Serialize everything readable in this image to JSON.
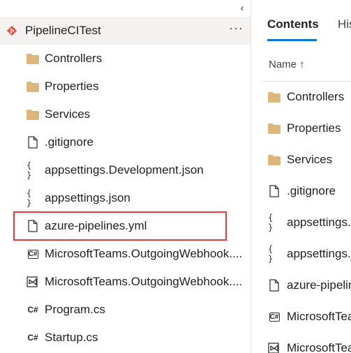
{
  "tree": {
    "collapse_glyph": "‹",
    "repo": {
      "name": "PipelineCITest",
      "icon": "git-repo-icon",
      "more": "···"
    },
    "items": [
      {
        "label": "Controllers",
        "icon": "folder-icon"
      },
      {
        "label": "Properties",
        "icon": "folder-icon"
      },
      {
        "label": "Services",
        "icon": "folder-icon"
      },
      {
        "label": ".gitignore",
        "icon": "file-icon"
      },
      {
        "label": "appsettings.Development.json",
        "icon": "json-icon"
      },
      {
        "label": "appsettings.json",
        "icon": "json-icon"
      },
      {
        "label": "azure-pipelines.yml",
        "icon": "file-icon",
        "highlighted": true
      },
      {
        "label": "MicrosoftTeams.OutgoingWebhook....",
        "icon": "csproj-icon"
      },
      {
        "label": "MicrosoftTeams.OutgoingWebhook....",
        "icon": "solution-icon"
      },
      {
        "label": "Program.cs",
        "icon": "csharp-icon"
      },
      {
        "label": "Startup.cs",
        "icon": "csharp-icon"
      }
    ]
  },
  "contents": {
    "tabs": [
      {
        "label": "Contents",
        "active": true
      },
      {
        "label": "History",
        "active": false
      }
    ],
    "column_header": "Name ↑",
    "items": [
      {
        "label": "Controllers",
        "icon": "folder-icon"
      },
      {
        "label": "Properties",
        "icon": "folder-icon"
      },
      {
        "label": "Services",
        "icon": "folder-icon"
      },
      {
        "label": ".gitignore",
        "icon": "file-icon"
      },
      {
        "label": "appsettings.Development.json",
        "icon": "json-icon"
      },
      {
        "label": "appsettings.json",
        "icon": "json-icon"
      },
      {
        "label": "azure-pipelines.yml",
        "icon": "file-icon"
      },
      {
        "label": "MicrosoftTeams.OutgoingWebhook.csproj",
        "icon": "csproj-icon"
      },
      {
        "label": "MicrosoftTeams.OutgoingWebhook.sln",
        "icon": "solution-icon"
      }
    ]
  },
  "colors": {
    "accent": "#0078d4",
    "repo_icon": "#e0553b",
    "folder": "#dcb67a",
    "highlight_border": "#e5383b",
    "selected_row": "#f3f2f1"
  }
}
